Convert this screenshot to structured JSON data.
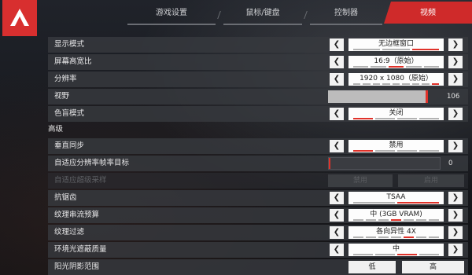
{
  "tabs": [
    {
      "label": "游戏设置",
      "active": false
    },
    {
      "label": "鼠标/键盘",
      "active": false
    },
    {
      "label": "控制器",
      "active": false
    },
    {
      "label": "视频",
      "active": true
    }
  ],
  "rows": {
    "display_mode": {
      "label": "显示模式",
      "value": "无边框窗口"
    },
    "aspect_ratio": {
      "label": "屏幕高宽比",
      "value": "16:9（原始）"
    },
    "resolution": {
      "label": "分辨率",
      "value": "1920 x 1080（原始）"
    },
    "fov": {
      "label": "视野",
      "value": "106",
      "level_percent": 98
    },
    "colorblind": {
      "label": "色盲模式",
      "value": "关闭"
    },
    "vsync": {
      "label": "垂直同步",
      "value": "禁用"
    },
    "adaptive_res": {
      "label": "自适应分辨率帧率目标",
      "value": "0",
      "level_percent": 0
    },
    "adaptive_supersample": {
      "label": "自适应超级采样",
      "option_a": "禁用",
      "option_b": "启用"
    },
    "anti_aliasing": {
      "label": "抗锯齿",
      "value": "TSAA"
    },
    "texture_budget": {
      "label": "纹理串流预算",
      "value": "中 (3GB VRAM)"
    },
    "texture_filter": {
      "label": "纹理过滤",
      "value": "各向异性 4X"
    },
    "ambient_occlusion": {
      "label": "环境光遮蔽质量",
      "value": "中"
    },
    "sun_shadow": {
      "label": "阳光阴影范围",
      "option_a": "低",
      "option_b": "高"
    }
  },
  "section_advanced": "高级",
  "colors": {
    "accent": "#d82f2f",
    "tick_on": "#e0322a"
  }
}
